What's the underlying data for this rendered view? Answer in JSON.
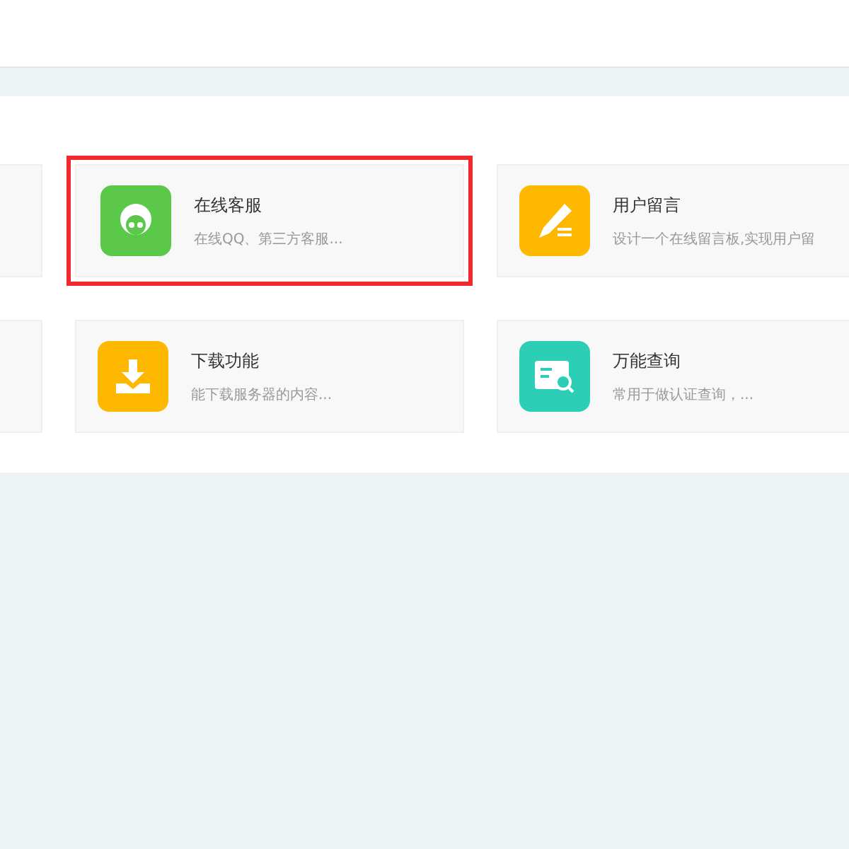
{
  "rows": [
    {
      "cards": [
        {
          "kind": "person",
          "color": "#5cc84a",
          "title": "在线客服",
          "description": "在线QQ、第三方客服...",
          "highlighted": true
        },
        {
          "kind": "pencil",
          "color": "#ffb800",
          "title": "用户留言",
          "description": "设计一个在线留言板,实现用户留",
          "highlighted": false
        }
      ]
    },
    {
      "cards": [
        {
          "kind": "download",
          "color": "#ffb800",
          "title": "下载功能",
          "description": "能下载服务器的内容...",
          "highlighted": false
        },
        {
          "kind": "search-card",
          "color": "#2ccfb5",
          "title": "万能查询",
          "description": "常用于做认证查询，...",
          "highlighted": false
        }
      ]
    }
  ]
}
